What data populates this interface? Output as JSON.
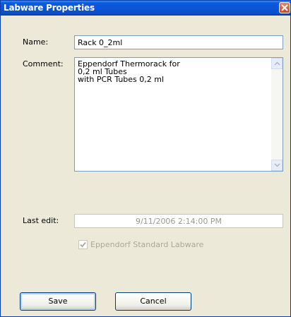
{
  "window": {
    "title": "Labware Properties"
  },
  "labels": {
    "name": "Name:",
    "comment": "Comment:",
    "last_edit": "Last edit:"
  },
  "fields": {
    "name_value": "Rack 0_2ml",
    "comment_value": "Eppendorf Thermorack for\n0,2 ml Tubes\nwith PCR Tubes 0,2 ml",
    "last_edit_value": "9/11/2006  2:14:00 PM"
  },
  "checkbox": {
    "label": "Eppendorf Standard Labware",
    "checked": true,
    "enabled": false
  },
  "buttons": {
    "save": "Save",
    "cancel": "Cancel"
  },
  "colors": {
    "titlebar": "#0a55d8",
    "dialog_bg": "#ece9d8",
    "close": "#d0431f"
  },
  "icons": {
    "close": "close-icon",
    "scroll_up": "chevron-up-icon",
    "scroll_down": "chevron-down-icon",
    "check": "checkmark-icon"
  }
}
